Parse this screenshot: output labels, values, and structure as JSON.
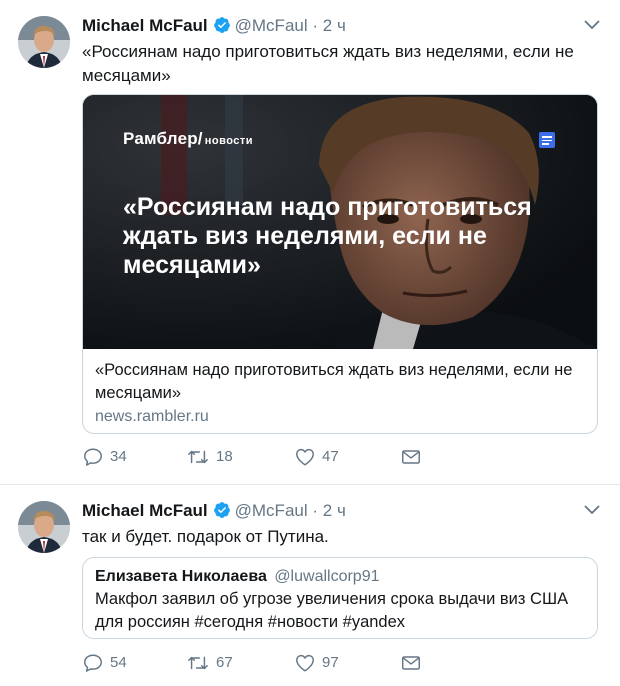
{
  "tweets": [
    {
      "author": "Michael McFaul",
      "handle": "@McFaul",
      "separator": "·",
      "time": "2 ч",
      "text": "«Россиянам надо приготовиться ждать виз неделями, если не месяцами»",
      "card": {
        "brand": "Рамблер/",
        "brand_sub": "новости",
        "headline": "«Россиянам надо приготовиться ждать виз неделями, если не месяцами»",
        "title": "«Россиянам надо приготовиться ждать виз неделями, если не месяцами»",
        "domain": "news.rambler.ru"
      },
      "actions": {
        "replies": "34",
        "retweets": "18",
        "likes": "47"
      }
    },
    {
      "author": "Michael McFaul",
      "handle": "@McFaul",
      "separator": "·",
      "time": "2 ч",
      "text": "так и будет. подарок от Путина.",
      "quote": {
        "author": "Елизавета Николаева",
        "handle": "@luwallcorp91",
        "text": "Макфол заявил об угрозе увеличения срока выдачи виз США для россиян #сегодня #новости #yandex"
      },
      "actions": {
        "replies": "54",
        "retweets": "67",
        "likes": "97"
      }
    }
  ],
  "icons": {
    "verified": "verified-badge-icon",
    "reply": "reply-icon",
    "retweet": "retweet-icon",
    "like": "heart-icon",
    "dm": "envelope-icon",
    "menu": "chevron-down-icon"
  },
  "colors": {
    "verified": "#1da1f2",
    "secondary_text": "#657786",
    "border": "#ccd6dd",
    "rambler_badge": "#3b6ee8"
  }
}
